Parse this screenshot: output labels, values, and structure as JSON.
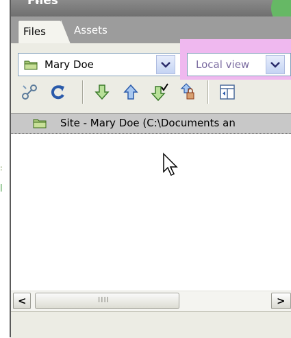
{
  "window": {
    "title": "Files"
  },
  "tabs": [
    {
      "label": "Files",
      "active": true
    },
    {
      "label": "Assets",
      "active": false
    }
  ],
  "site_select": {
    "value": "Mary Doe"
  },
  "view_select": {
    "value": "Local view",
    "highlight_color": "#efb8ef"
  },
  "toolbar": {
    "icons": [
      "connect-icon",
      "refresh-icon",
      "get-files-icon",
      "put-files-icon",
      "check-out-icon",
      "check-in-icon",
      "expand-icon"
    ]
  },
  "file_tree": {
    "site_label": "Site - Mary Doe (C:\\Documents an"
  },
  "scrollbar": {
    "left_arrow": "<",
    "right_arrow": ">",
    "grip": "IIII"
  },
  "colors": {
    "accent": "#66b865",
    "header_row": "#c8c8c8"
  }
}
